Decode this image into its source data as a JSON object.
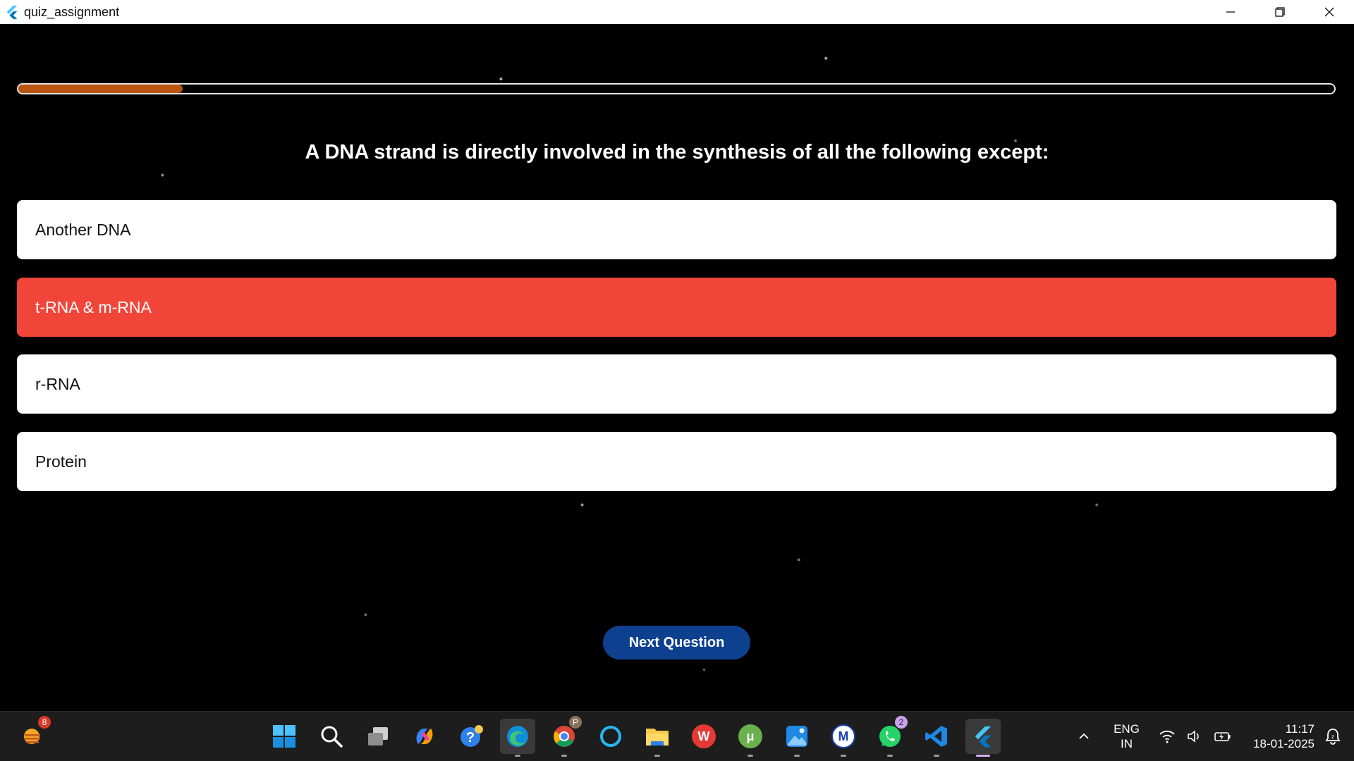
{
  "window": {
    "title": "quiz_assignment"
  },
  "quiz": {
    "progress": 0.125,
    "question": "A DNA strand is directly involved in the synthesis of all the following except:",
    "options": [
      {
        "label": "Another DNA",
        "state": "default"
      },
      {
        "label": "t-RNA & m-RNA",
        "state": "wrong"
      },
      {
        "label": "r-RNA",
        "state": "default"
      },
      {
        "label": "Protein",
        "state": "default"
      }
    ],
    "next_label": "Next Question"
  },
  "colors": {
    "progress_fill": "#b9550f",
    "wrong_option": "#f2453a",
    "next_button": "#0d4190"
  },
  "taskbar": {
    "weather_badge": "8",
    "apps": [
      {
        "icon": "windows-start-icon"
      },
      {
        "icon": "search-icon"
      },
      {
        "icon": "task-view-icon"
      },
      {
        "icon": "copilot-icon"
      },
      {
        "icon": "help-icon"
      },
      {
        "icon": "edge-icon"
      },
      {
        "icon": "chrome-icon",
        "badge": "P"
      },
      {
        "icon": "cortana-icon"
      },
      {
        "icon": "file-explorer-icon"
      },
      {
        "icon": "wps-office-icon",
        "glyph": "W"
      },
      {
        "icon": "utorrent-icon",
        "glyph": "μ"
      },
      {
        "icon": "photos-icon"
      },
      {
        "icon": "app-icon",
        "glyph": "M"
      },
      {
        "icon": "whatsapp-icon",
        "badge": "2"
      },
      {
        "icon": "vscode-icon"
      },
      {
        "icon": "flutter-icon"
      }
    ],
    "language_top": "ENG",
    "language_bottom": "IN",
    "time": "11:17",
    "date": "18-01-2025"
  }
}
